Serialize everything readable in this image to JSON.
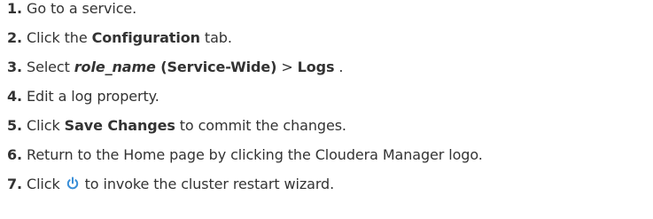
{
  "steps": [
    {
      "num": "1.",
      "text": "Go to a service."
    },
    {
      "num": "2.",
      "pre": "Click the ",
      "bold": "Configuration",
      "post": " tab."
    },
    {
      "num": "3.",
      "pre": "Select ",
      "bold_italic": "role_name",
      "bold": " (Service-Wide)",
      "mid": " > ",
      "bold2": "Logs",
      "post": " ."
    },
    {
      "num": "4.",
      "text": "Edit a log property."
    },
    {
      "num": "5.",
      "pre": "Click ",
      "bold": "Save Changes",
      "post": " to commit the changes."
    },
    {
      "num": "6.",
      "text": "Return to the Home page by clicking the Cloudera Manager logo."
    },
    {
      "num": "7.",
      "pre": "Click ",
      "icon": "restart-icon",
      "post": " to invoke the cluster restart wizard."
    }
  ],
  "colors": {
    "text": "#333333",
    "icon": "#3a8fd8"
  }
}
